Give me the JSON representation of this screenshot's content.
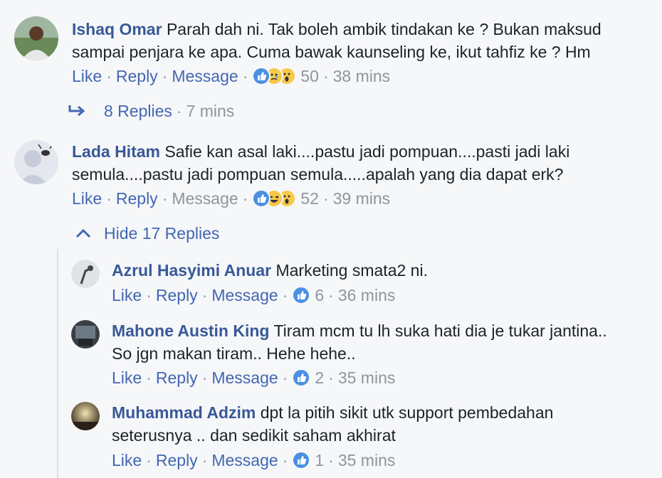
{
  "actions": {
    "like": "Like",
    "reply": "Reply",
    "message": "Message",
    "sep": "·"
  },
  "comments": [
    {
      "author": "Ishaq Omar",
      "text_line1": "Parah dah ni. Tak boleh ambik tindakan ke ? Bukan maksud",
      "text_line2": "sampai penjara ke apa. Cuma bawak kaunseling ke, ikut tahfiz ke ? Hm",
      "reaction_icons": [
        "like-icon",
        "sad-icon",
        "wow-icon"
      ],
      "reaction_count": "50",
      "time": "38 mins",
      "replies_label": "8 Replies",
      "replies_time": "7 mins"
    },
    {
      "author": "Lada Hitam",
      "text_line1": "Safie kan asal laki....pastu jadi pompuan....pasti jadi laki",
      "text_line2": "semula....pastu jadi pompuan semula.....apalah yang dia dapat erk?",
      "reaction_icons": [
        "like-icon",
        "haha-icon",
        "wow-icon"
      ],
      "reaction_count": "52",
      "time": "39 mins",
      "hide_replies_label": "Hide 17 Replies",
      "replies": [
        {
          "author": "Azrul Hasyimi Anuar",
          "text_line1": "Marketing smata2 ni.",
          "text_line2": "",
          "reaction_count": "6",
          "time": "36 mins"
        },
        {
          "author": "Mahone Austin King",
          "text_line1": "Tiram mcm tu lh suka hati dia je tukar jantina..",
          "text_line2": "So jgn makan tiram.. Hehe hehe..",
          "reaction_count": "2",
          "time": "35 mins"
        },
        {
          "author": "Muhammad Adzim",
          "text_line1": "dpt la pitih sikit utk support pembedahan",
          "text_line2": "seterusnya .. dan sedikit saham akhirat",
          "reaction_count": "1",
          "time": "35 mins"
        }
      ]
    }
  ],
  "colors": {
    "link": "#4267b2",
    "author": "#385898",
    "muted": "#90949c",
    "like": "#4a90e2",
    "emoji": "#f7c948"
  }
}
